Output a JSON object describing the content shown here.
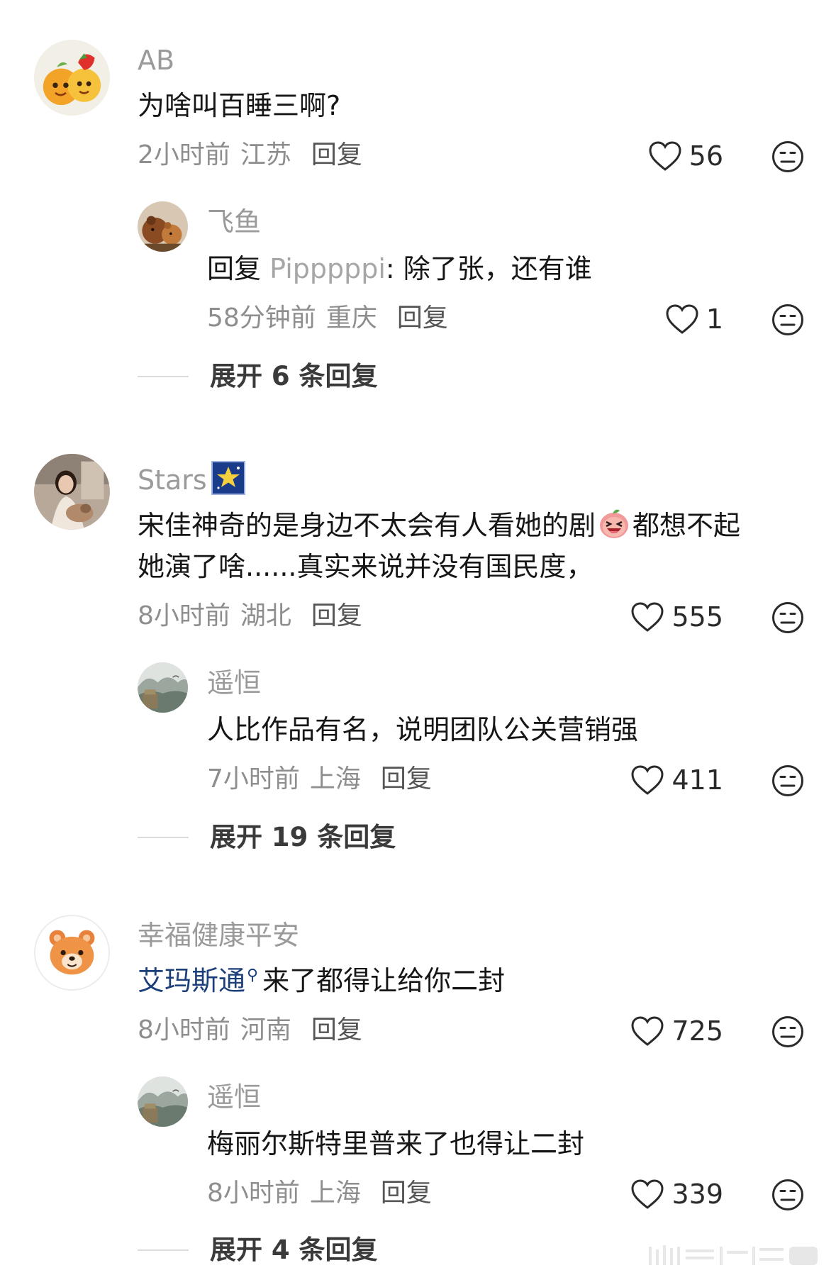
{
  "theme": {
    "username_color": "#9a9a9a",
    "text_color": "#161616",
    "meta_color": "#8e8e8e",
    "mention_color": "#1c3f7a"
  },
  "icons": {
    "like": "heart-outline-icon",
    "dislike": "neutral-face-icon"
  },
  "comments": [
    {
      "username": "AB",
      "text": "为啥叫百睡三啊?",
      "time": "2小时前",
      "location": "江苏",
      "reply_label": "回复",
      "likes": "56",
      "sub_reply": {
        "username": "飞鱼",
        "reply_word": "回复",
        "reply_to": "Pipppppi",
        "text": ": 除了张，还有谁",
        "time": "58分钟前",
        "location": "重庆",
        "reply_label": "回复",
        "likes": "1"
      },
      "expand_label": "展开 6 条回复"
    },
    {
      "username": "Stars",
      "text_line1_a": "宋佳神奇的是身边不太会有人看她的剧",
      "text_line1_b": "都想不起",
      "text_line2": "她演了啥......真实来说并没有国民度，",
      "time": "8小时前",
      "location": "湖北",
      "reply_label": "回复",
      "likes": "555",
      "sub_reply": {
        "username": "遥恒",
        "text": "人比作品有名，说明团队公关营销强",
        "time": "7小时前",
        "location": "上海",
        "reply_label": "回复",
        "likes": "411"
      },
      "expand_label": "展开 19 条回复"
    },
    {
      "username": "幸福健康平安",
      "mention": "艾玛斯通",
      "text": "来了都得让给你二封",
      "time": "8小时前",
      "location": "河南",
      "reply_label": "回复",
      "likes": "725",
      "sub_reply": {
        "username": "遥恒",
        "text": "梅丽尔斯特里普来了也得让二封",
        "time": "8小时前",
        "location": "上海",
        "reply_label": "回复",
        "likes": "339"
      },
      "expand_label": "展开 4 条回复"
    }
  ]
}
